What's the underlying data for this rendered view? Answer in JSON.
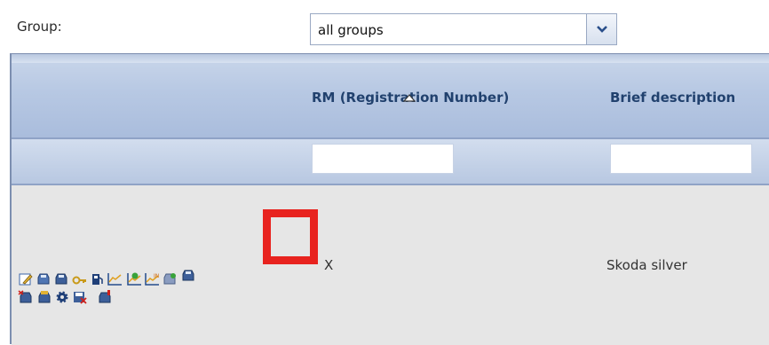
{
  "filter": {
    "label": "Group:",
    "selected": "all groups"
  },
  "table": {
    "columns": [
      "RM (Registration Number)",
      "Brief description"
    ],
    "sort_indicator": "ascending",
    "rows": [
      {
        "rm": "X",
        "description": "Skoda silver"
      }
    ]
  },
  "row_actions": [
    "edit-icon",
    "car-icon",
    "car-icon",
    "key-icon",
    "fuel-icon",
    "chart-icon",
    "chart-check-icon",
    "chart-in-icon",
    "car-icon",
    "car-icon",
    "car-delete-icon",
    "car-folder-icon",
    "gear-icon",
    "save-delete-icon",
    "car-alert-icon"
  ],
  "colors": {
    "header": "#b7c8e3",
    "header_text": "#21416e",
    "row_bg": "#e6e6e6",
    "highlight": "#e8231f"
  }
}
